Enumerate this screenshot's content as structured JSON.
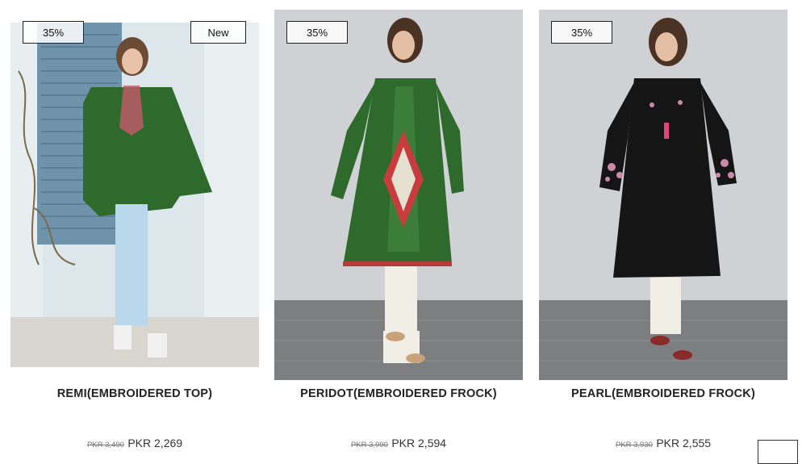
{
  "products": [
    {
      "badge_discount": "35%",
      "badge_new": "New",
      "title": "REMI(EMBROIDERED TOP)",
      "old_price": "PKR 3,490",
      "price": "PKR 2,269"
    },
    {
      "badge_discount": "35%",
      "title": "PERIDOT(EMBROIDERED FROCK)",
      "old_price": "PKR 3,990",
      "price": "PKR 2,594"
    },
    {
      "badge_discount": "35%",
      "title": "PEARL(EMBROIDERED FROCK)",
      "old_price": "PKR 3,930",
      "price": "PKR 2,555"
    }
  ],
  "colors": {
    "green_dress": "#2e6a2c",
    "black_dress": "#151515",
    "studio_bg": "#cfd1d4",
    "floor": "#7d7e80",
    "shutter": "#6f93ab"
  }
}
